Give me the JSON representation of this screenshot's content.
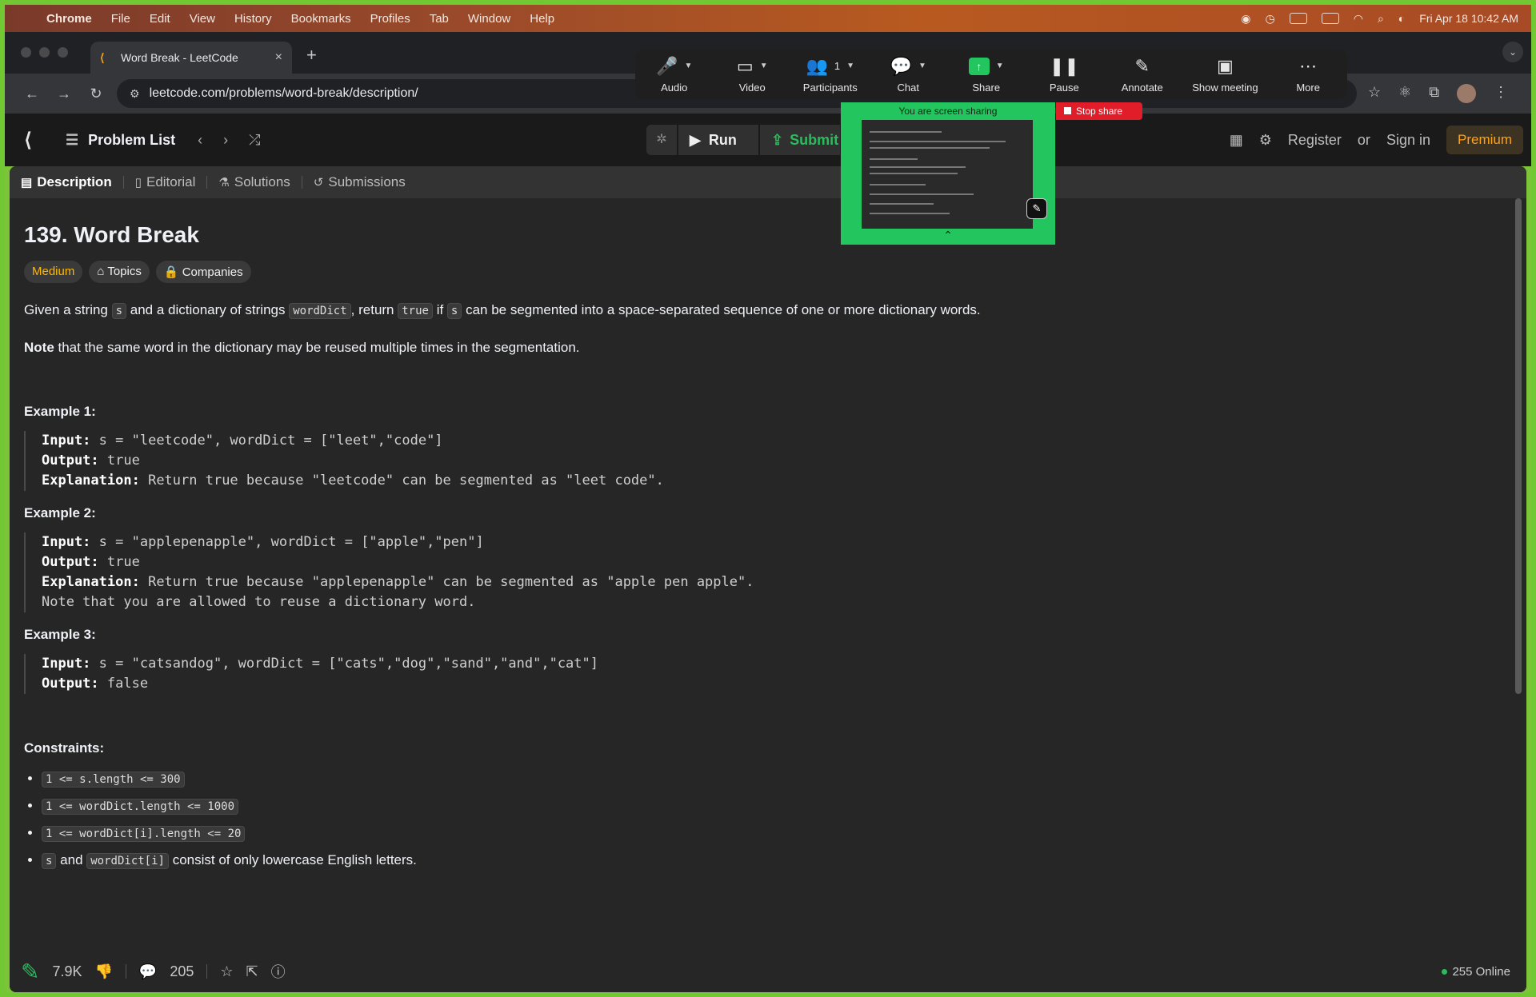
{
  "menubar": {
    "items": [
      "Chrome",
      "File",
      "Edit",
      "View",
      "History",
      "Bookmarks",
      "Profiles",
      "Tab",
      "Window",
      "Help"
    ],
    "clock": "Fri Apr 18  10:42 AM"
  },
  "browser": {
    "tab_title": "Word Break - LeetCode",
    "url": "leetcode.com/problems/word-break/description/"
  },
  "zoom": {
    "buttons": {
      "audio": "Audio",
      "video": "Video",
      "participants": "Participants",
      "participants_count": "1",
      "chat": "Chat",
      "share": "Share",
      "pause": "Pause",
      "annotate": "Annotate",
      "show_meeting": "Show meeting",
      "more": "More"
    },
    "sharing_banner": "You are screen sharing",
    "stop_share": "Stop share"
  },
  "leetcode": {
    "problem_list": "Problem List",
    "run": "Run",
    "submit": "Submit",
    "register": "Register",
    "or": "or",
    "sign_in": "Sign in",
    "premium": "Premium"
  },
  "panel_tabs": {
    "description": "Description",
    "editorial": "Editorial",
    "solutions": "Solutions",
    "submissions": "Submissions"
  },
  "problem": {
    "title": "139. Word Break",
    "difficulty": "Medium",
    "topics": "Topics",
    "companies": "Companies",
    "desc": {
      "t1": "Given a string ",
      "c1": "s",
      "t2": " and a dictionary of strings ",
      "c2": "wordDict",
      "t3": ", return ",
      "c3": "true",
      "t4": " if ",
      "c4": "s",
      "t5": " can be segmented into a space-separated sequence of one or more dictionary words."
    },
    "note_bold": "Note",
    "note_rest": " that the same word in the dictionary may be reused multiple times in the segmentation.",
    "examples": [
      {
        "heading": "Example 1:",
        "input": "s = \"leetcode\", wordDict = [\"leet\",\"code\"]",
        "output": "true",
        "explanation": "Return true because \"leetcode\" can be segmented as \"leet code\"."
      },
      {
        "heading": "Example 2:",
        "input": "s = \"applepenapple\", wordDict = [\"apple\",\"pen\"]",
        "output": "true",
        "explanation": "Return true because \"applepenapple\" can be segmented as \"apple pen apple\".",
        "extra": "Note that you are allowed to reuse a dictionary word."
      },
      {
        "heading": "Example 3:",
        "input": "s = \"catsandog\", wordDict = [\"cats\",\"dog\",\"sand\",\"and\",\"cat\"]",
        "output": "false"
      }
    ],
    "labels": {
      "input": "Input:",
      "output": "Output:",
      "explanation": "Explanation:"
    },
    "constraints_heading": "Constraints:",
    "constraints": [
      "1 <= s.length <= 300",
      "1 <= wordDict.length <= 1000",
      "1 <= wordDict[i].length <= 20"
    ],
    "last_constraint": {
      "c1": "s",
      "t1": " and ",
      "c2": "wordDict[i]",
      "t2": " consist of only lowercase English letters."
    }
  },
  "bottom": {
    "likes": "7.9K",
    "comments": "205",
    "online": "255 Online"
  },
  "colors": {
    "share_green": "#22c55e",
    "leetcode_orange": "#ffa116",
    "medium_yellow": "#ffb800",
    "submit_green": "#2cbb5d"
  }
}
